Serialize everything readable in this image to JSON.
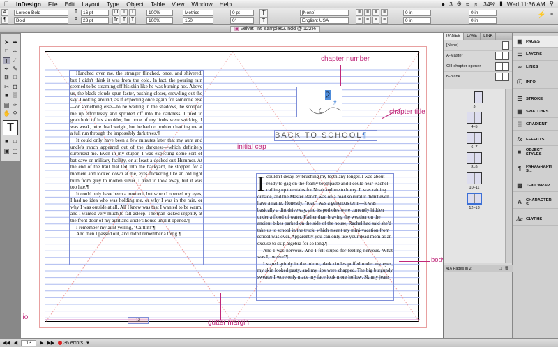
{
  "menubar": {
    "app": "InDesign",
    "items": [
      "File",
      "Edit",
      "Layout",
      "Type",
      "Object",
      "Table",
      "View",
      "Window",
      "Help"
    ],
    "badge": "3",
    "battery": "34%",
    "clock": "Wed 11:36 AM"
  },
  "control": {
    "font_family": "Loreen Bold",
    "font_style": "Bold",
    "font_size": "16 pt",
    "leading": "23 pt",
    "scale_v": "100%",
    "scale_h": "100%",
    "kerning": "Metrics",
    "tracking": "150",
    "baseline": "0 pt",
    "skew": "0°",
    "char_style": "[None]",
    "language": "English: USA",
    "indent_left": "0 in",
    "indent_right": "0 in",
    "space_before": "0 in",
    "space_after": "0 in"
  },
  "document": {
    "tab_title": "Velvet_int_samples2.indd @ 122%"
  },
  "left_page": {
    "paragraphs": [
      "Hunched over me, the stranger flinched, once, and shivered, but I didn't think it was from the cold. In fact, the pouring rain seemed to be steaming off his skin like he was burning hot. Above us, the black clouds spun faster, pushing closer, crowding out the sky. Looking around, as if expecting once again for someone else—or something else—to be waiting in the shadows, he scooped me up effortlessly and sprinted off into the darkness. I tried to grab hold of his shoulder, but none of my limbs were working. I was weak, pure dead weight, but he had no problem hauling me at a full run through the impossibly dark trees.¶",
      "It could only have been a few minutes later that my aunt and uncle's ranch appeared out of the darkness—which definitely surprised me. Even in my stupor, I was expecting some sort of bat-cave or military facility, or at least a decked-out Hummer. At the end of the trail that led into the backyard, he stopped for a moment and looked down at me, eyes flickering like an old light bulb from grey to molten silver. I tried to look away, but it was too late.¶",
      "It could only have been a moment, but when I opened my eyes, I had no idea who was holding me, or why I was in the rain, or why I was outside at all. All I knew was that I wanted to be warm, and I wanted very much to fall asleep. The man kicked urgently at the front door of my aunt and uncle's house until it opened.¶",
      "I remember my aunt yelling, \"Caitlin!\"¶",
      "And then I passed out, and didn't remember a thing.¶"
    ],
    "folio": "12"
  },
  "right_page": {
    "chapter_number": "2",
    "chapter_title": "BACK TO SCHOOL",
    "initial_cap": "I",
    "first_line": "couldn't delay by brushing my teeth any longer. I was about ready to gag on the foamy toothpaste and I could hear Rachel calling up the stairs for Noah and me to hurry. It was raining outside, and the Master Ranch was on a road so rural it didn't even have a name. Honestly, \"road\" was a generous term—it was basically a dirt driveway, and its potholes were currently hidden under a flood of water. Rather than braving the weather on the ancient bikes parked on the side of the house, Rachel had said she'd take us to school in the truck, which meant my mini-vacation from school was over. Apparently you can only use your dead mom as an excuse to skip algebra for so long.¶",
    "paragraphs": [
      "And I was nervous. And I felt stupid for feeling nervous. What was I, twelve?¶",
      "I stared grimly in the mirror, dark circles puffed under my eyes, my skin looked pasty, and my lips were chapped. The big burgundy sweater I wore only made my face look more hollow. Skinny jeans"
    ]
  },
  "annotations": {
    "chapter_number": "chapter number",
    "chapter_title": "chapter title",
    "initial_cap": "initial cap",
    "body_text": "body text",
    "folio": "folio",
    "gutter_margin": "gutter margin"
  },
  "pages_panel": {
    "tabs": [
      "PAGES",
      "LAYE",
      "LINK"
    ],
    "masters": [
      "[None]",
      "A-Master",
      "CH-chapter opener",
      "B-blank"
    ],
    "spreads": [
      "3",
      "4–5",
      "6–7",
      "8–9",
      "10–11",
      "12–13"
    ],
    "footer": "416 Pages in 2"
  },
  "dock": {
    "items": [
      "PAGES",
      "LAYERS",
      "LINKS",
      "INFO",
      "STROKE",
      "SWATCHES",
      "GRADIENT",
      "EFFECTS",
      "OBJECT STYLES",
      "PARAGRAPH S...",
      "TEXT WRAP",
      "CHARACTER S...",
      "GLYPHS"
    ]
  },
  "status": {
    "page": "13",
    "errors": "36 errors"
  },
  "colors": {
    "annotation": "#c0287a",
    "frame_edge": "#7f8fd8",
    "baseline_grid": "#aebcf0",
    "bleed": "#e8a0a0"
  }
}
